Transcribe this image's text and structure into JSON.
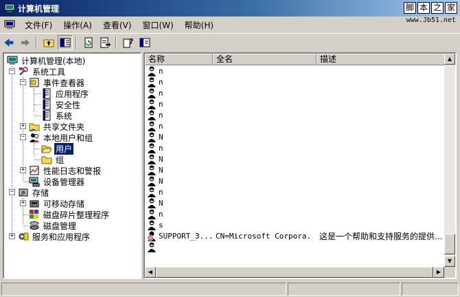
{
  "window": {
    "title": "计算机管理",
    "watermark_chars": [
      "脚",
      "本",
      "之",
      "家"
    ],
    "watermark_url": "www.Jb51.net"
  },
  "menu": [
    {
      "label": "文件(F)"
    },
    {
      "label": "操作(A)"
    },
    {
      "label": "查看(V)"
    },
    {
      "label": "窗口(W)"
    },
    {
      "label": "帮助(H)"
    }
  ],
  "toolbar": {
    "buttons": [
      "back-icon",
      "forward-icon",
      "up-icon",
      "show-hide-tree-icon",
      "refresh-icon",
      "export-list-icon",
      "help-icon",
      "properties-icon"
    ]
  },
  "tree": {
    "root": "计算机管理(本地)",
    "system_tools": "系统工具",
    "event_viewer": "事件查看器",
    "application": "应用程序",
    "security": "安全性",
    "system": "系统",
    "shared_folders": "共享文件夹",
    "local_users_groups": "本地用户和组",
    "users": "用户",
    "groups": "组",
    "perf_logs": "性能日志和警报",
    "device_manager": "设备管理器",
    "storage": "存储",
    "removable_storage": "可移动存储",
    "defrag": "磁盘碎片整理程序",
    "disk_management": "磁盘管理",
    "services_apps": "服务和应用程序"
  },
  "list": {
    "columns": [
      "名称",
      "全名",
      "描述"
    ],
    "rows": [
      {
        "name": "n",
        "full_name": "",
        "description": ""
      },
      {
        "name": "n",
        "full_name": "",
        "description": ""
      },
      {
        "name": "n",
        "full_name": "",
        "description": ""
      },
      {
        "name": "n",
        "full_name": "",
        "description": ""
      },
      {
        "name": "n",
        "full_name": "",
        "description": ""
      },
      {
        "name": "n",
        "full_name": "",
        "description": ""
      },
      {
        "name": "N",
        "full_name": "",
        "description": ""
      },
      {
        "name": "n",
        "full_name": "",
        "description": ""
      },
      {
        "name": "N",
        "full_name": "",
        "description": ""
      },
      {
        "name": "N",
        "full_name": "",
        "description": ""
      },
      {
        "name": "N",
        "full_name": "",
        "description": ""
      },
      {
        "name": "n",
        "full_name": "",
        "description": ""
      },
      {
        "name": "N",
        "full_name": "",
        "description": ""
      },
      {
        "name": "n",
        "full_name": "",
        "description": ""
      },
      {
        "name": "s",
        "full_name": "",
        "description": ""
      },
      {
        "name": "SUPPORT_3...",
        "full_name": "CN=Microsoft Corpora...",
        "description": "这是一个帮助和支持服务的提供...",
        "disabled": true
      },
      {
        "name": "",
        "full_name": "",
        "description": ""
      }
    ]
  },
  "colors": {
    "title_gradient_start": "#0a246a",
    "title_gradient_end": "#a6caf0",
    "selection": "#0a246a",
    "face": "#d4d0c8"
  }
}
